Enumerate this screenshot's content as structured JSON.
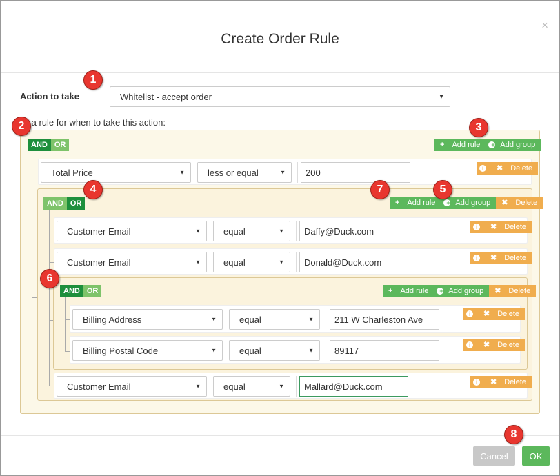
{
  "modal": {
    "title": "Create Order Rule",
    "close_glyph": "×"
  },
  "action": {
    "label": "Action to take",
    "selected": "Whitelist - accept order"
  },
  "build_label": "ild a rule for when to take this action:",
  "andor": {
    "and": "AND",
    "or": "OR"
  },
  "buttons": {
    "add_rule": "Add rule",
    "add_group": "Add group",
    "delete": "Delete"
  },
  "root_rule": {
    "field": "Total Price",
    "operator": "less or equal",
    "value": "200"
  },
  "group1": {
    "rules": [
      {
        "field": "Customer Email",
        "operator": "equal",
        "value": "Daffy@Duck.com"
      },
      {
        "field": "Customer Email",
        "operator": "equal",
        "value": "Donald@Duck.com"
      }
    ],
    "last_rule": {
      "field": "Customer Email",
      "operator": "equal",
      "value": "Mallard@Duck.com"
    }
  },
  "group2": {
    "rules": [
      {
        "field": "Billing Address",
        "operator": "equal",
        "value": "211 W Charleston Ave"
      },
      {
        "field": "Billing Postal Code",
        "operator": "equal",
        "value": "89117"
      }
    ]
  },
  "badges": [
    "1",
    "2",
    "3",
    "4",
    "5",
    "6",
    "7",
    "8"
  ],
  "footer": {
    "cancel": "Cancel",
    "ok": "OK"
  },
  "colors": {
    "and": "#1e8f3c",
    "or": "#7ec36a",
    "add": "#5cb85c",
    "delete": "#f0ad4e",
    "badge": "#e8362f"
  }
}
